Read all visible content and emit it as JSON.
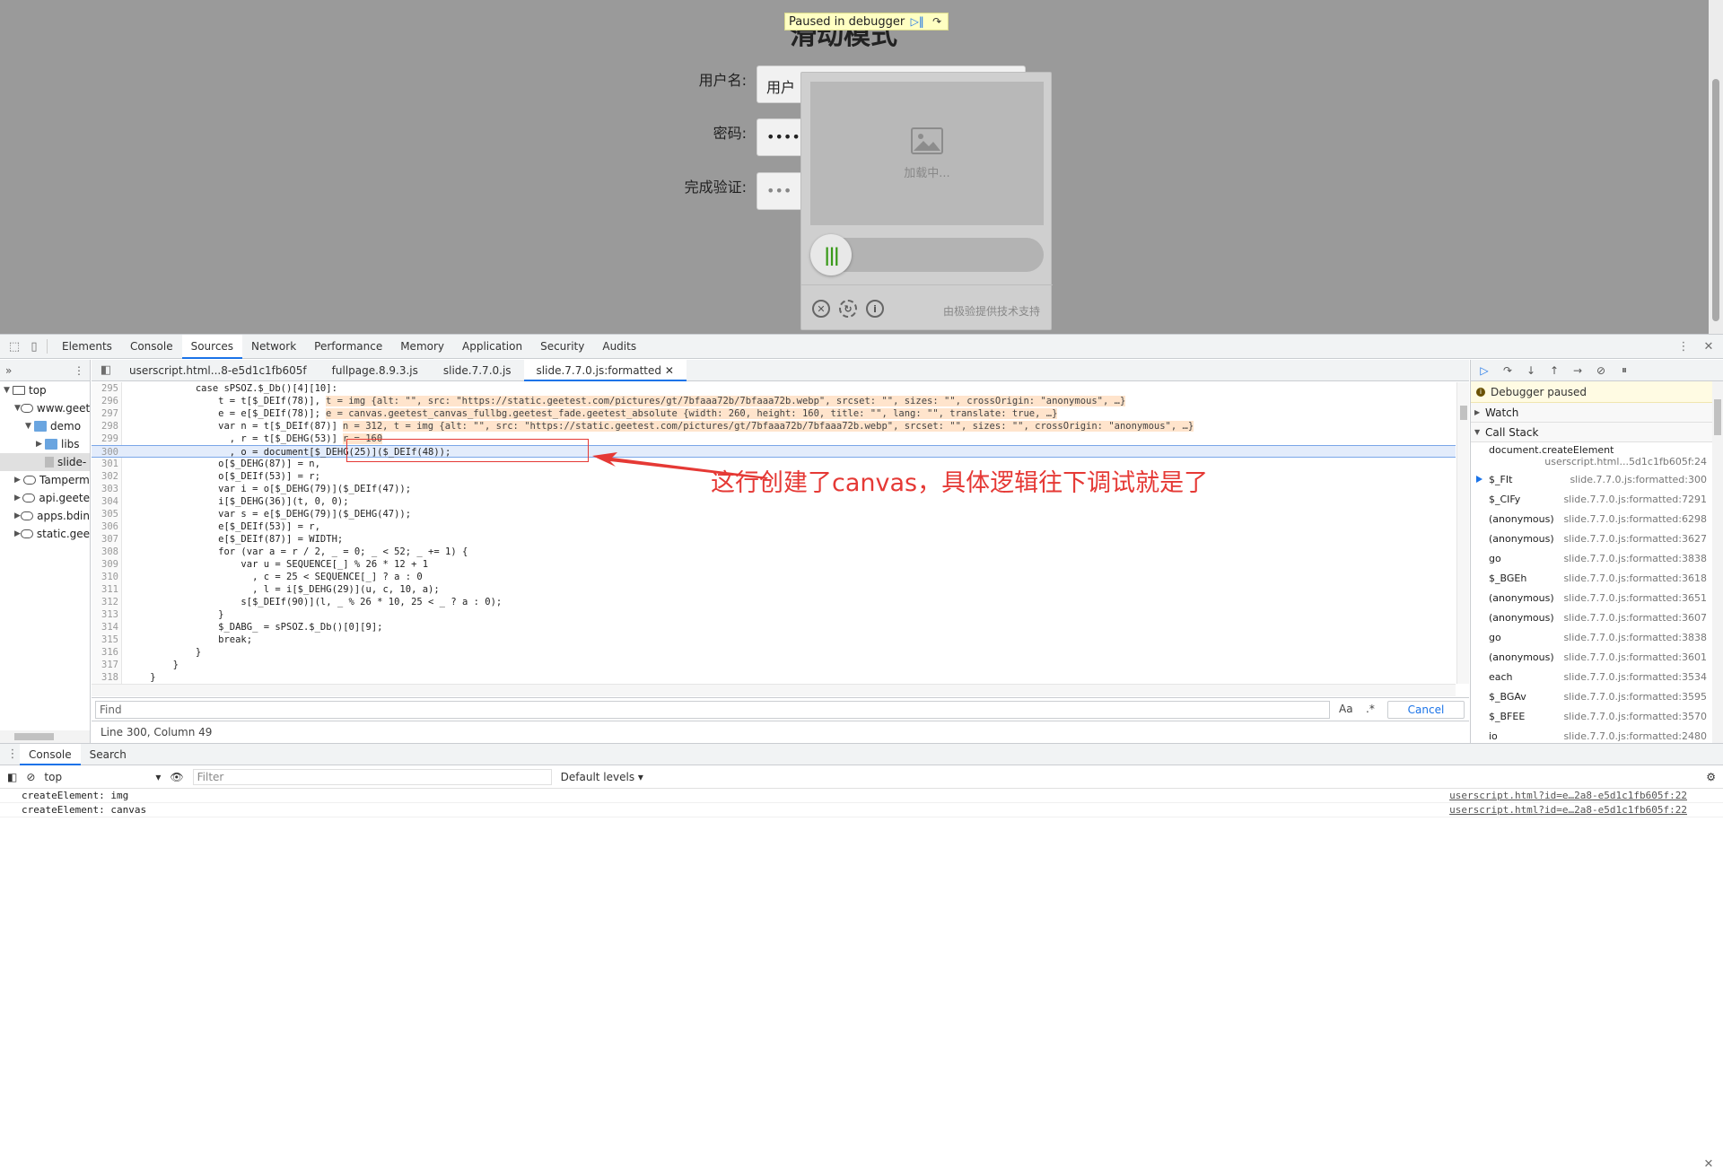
{
  "page": {
    "title": "滑动模式",
    "paused_text": "Paused in debugger",
    "username_label": "用户名:",
    "username_value": "用户",
    "password_label": "密码:",
    "password_value": "••••••",
    "verify_label": "完成验证:",
    "verify_value": "•••",
    "captcha_loading": "加载中...",
    "captcha_credit": "由极验提供技术支持"
  },
  "devtools": {
    "tabs": [
      "Elements",
      "Console",
      "Sources",
      "Network",
      "Performance",
      "Memory",
      "Application",
      "Security",
      "Audits"
    ],
    "active_tab": "Sources",
    "file_tabs": [
      "userscript.html...8-e5d1c1fb605f",
      "fullpage.8.9.3.js",
      "slide.7.7.0.js",
      "slide.7.7.0.js:formatted"
    ],
    "tree": [
      {
        "label": "top",
        "depth": 0,
        "icon": "window",
        "expanded": true
      },
      {
        "label": "www.geet",
        "depth": 1,
        "icon": "cloud",
        "expanded": true
      },
      {
        "label": "demo",
        "depth": 2,
        "icon": "folder",
        "expanded": true
      },
      {
        "label": "libs",
        "depth": 3,
        "icon": "folder",
        "expanded": false
      },
      {
        "label": "slide-",
        "depth": 3,
        "icon": "file",
        "expanded": null
      },
      {
        "label": "Tamperm",
        "depth": 1,
        "icon": "cloud",
        "expanded": false
      },
      {
        "label": "api.geete",
        "depth": 1,
        "icon": "cloud",
        "expanded": false
      },
      {
        "label": "apps.bdin",
        "depth": 1,
        "icon": "cloud",
        "expanded": false
      },
      {
        "label": "static.gee",
        "depth": 1,
        "icon": "cloud",
        "expanded": false
      }
    ],
    "code_lines": [
      {
        "n": "295",
        "text": "            case sPSOZ.$_Db()[4][10]:",
        "inline": ""
      },
      {
        "n": "296",
        "text": "                t = t[$_DEIf(78)],",
        "inline": "t = img {alt: \"\", src: \"https://static.geetest.com/pictures/gt/7bfaaa72b/7bfaaa72b.webp\", srcset: \"\", sizes: \"\", crossOrigin: \"anonymous\", …}"
      },
      {
        "n": "297",
        "text": "                e = e[$_DEIf(78)];",
        "inline": "e = canvas.geetest_canvas_fullbg.geetest_fade.geetest_absolute {width: 260, height: 160, title: \"\", lang: \"\", translate: true, …}"
      },
      {
        "n": "298",
        "text": "                var n = t[$_DEIf(87)]",
        "inline": "n = 312, t = img {alt: \"\", src: \"https://static.geetest.com/pictures/gt/7bfaaa72b/7bfaaa72b.webp\", srcset: \"\", sizes: \"\", crossOrigin: \"anonymous\", …}"
      },
      {
        "n": "299",
        "text": "                  , r = t[$_DEHG(53)]",
        "inline": "r = 160"
      },
      {
        "n": "300",
        "text": "                  , o = document[$_DEHG(25)]($_DEIf(48));",
        "inline": ""
      },
      {
        "n": "301",
        "text": "                o[$_DEHG(87)] = n,",
        "inline": ""
      },
      {
        "n": "302",
        "text": "                o[$_DEIf(53)] = r;",
        "inline": ""
      },
      {
        "n": "303",
        "text": "                var i = o[$_DEHG(79)]($_DEIf(47));",
        "inline": ""
      },
      {
        "n": "304",
        "text": "                i[$_DEHG(36)](t, 0, 0);",
        "inline": ""
      },
      {
        "n": "305",
        "text": "                var s = e[$_DEHG(79)]($_DEHG(47));",
        "inline": ""
      },
      {
        "n": "306",
        "text": "                e[$_DEIf(53)] = r,",
        "inline": ""
      },
      {
        "n": "307",
        "text": "                e[$_DEIf(87)] = WIDTH;",
        "inline": ""
      },
      {
        "n": "308",
        "text": "                for (var a = r / 2, _ = 0; _ < 52; _ += 1) {",
        "inline": ""
      },
      {
        "n": "309",
        "text": "                    var u = SEQUENCE[_] % 26 * 12 + 1",
        "inline": ""
      },
      {
        "n": "310",
        "text": "                      , c = 25 < SEQUENCE[_] ? a : 0",
        "inline": ""
      },
      {
        "n": "311",
        "text": "                      , l = i[$_DEHG(29)](u, c, 10, a);",
        "inline": ""
      },
      {
        "n": "312",
        "text": "                    s[$_DEIf(90)](l, _ % 26 * 10, 25 < _ ? a : 0);",
        "inline": ""
      },
      {
        "n": "313",
        "text": "                }",
        "inline": ""
      },
      {
        "n": "314",
        "text": "                $_DABG_ = sPSOZ.$_Db()[0][9];",
        "inline": ""
      },
      {
        "n": "315",
        "text": "                break;",
        "inline": ""
      },
      {
        "n": "316",
        "text": "            }",
        "inline": ""
      },
      {
        "n": "317",
        "text": "        }",
        "inline": ""
      },
      {
        "n": "318",
        "text": "    }",
        "inline": ""
      },
      {
        "n": "319",
        "text": "",
        "inline": ""
      }
    ],
    "highlight_line": "300",
    "annotation": "这行创建了canvas，具体逻辑往下调试就是了",
    "find_placeholder": "Find",
    "find_case": "Aa",
    "find_regex": ".*",
    "find_cancel": "Cancel",
    "status": "Line 300, Column 49",
    "debugger_paused": "Debugger paused",
    "watch": "Watch",
    "call_stack": "Call Stack",
    "call_stack_items": [
      {
        "fn": "document.createElement",
        "loc": "userscript.html...5d1c1fb605f:24",
        "split": true
      },
      {
        "fn": "$_FIt",
        "loc": "slide.7.7.0.js:formatted:300",
        "current": true
      },
      {
        "fn": "$_CIFy",
        "loc": "slide.7.7.0.js:formatted:7291"
      },
      {
        "fn": "(anonymous)",
        "loc": "slide.7.7.0.js:formatted:6298"
      },
      {
        "fn": "(anonymous)",
        "loc": "slide.7.7.0.js:formatted:3627"
      },
      {
        "fn": "go",
        "loc": "slide.7.7.0.js:formatted:3838"
      },
      {
        "fn": "$_BGEh",
        "loc": "slide.7.7.0.js:formatted:3618"
      },
      {
        "fn": "(anonymous)",
        "loc": "slide.7.7.0.js:formatted:3651"
      },
      {
        "fn": "(anonymous)",
        "loc": "slide.7.7.0.js:formatted:3607"
      },
      {
        "fn": "go",
        "loc": "slide.7.7.0.js:formatted:3838"
      },
      {
        "fn": "(anonymous)",
        "loc": "slide.7.7.0.js:formatted:3601"
      },
      {
        "fn": "each",
        "loc": "slide.7.7.0.js:formatted:3534"
      },
      {
        "fn": "$_BGAv",
        "loc": "slide.7.7.0.js:formatted:3595"
      },
      {
        "fn": "$_BFEE",
        "loc": "slide.7.7.0.js:formatted:3570"
      },
      {
        "fn": "io",
        "loc": "slide.7.7.0.js:formatted:2480"
      }
    ]
  },
  "drawer": {
    "tabs": [
      "Console",
      "Search"
    ],
    "context": "top",
    "filter_placeholder": "Filter",
    "levels": "Default levels ▾",
    "rows": [
      {
        "text": "createElement: img",
        "src": "userscript.html?id=e…2a8-e5d1c1fb605f:22"
      },
      {
        "text": "createElement: canvas",
        "src": "userscript.html?id=e…2a8-e5d1c1fb605f:22"
      }
    ]
  },
  "colors": {
    "accent": "#1a73e8",
    "annotation": "#e53935"
  }
}
